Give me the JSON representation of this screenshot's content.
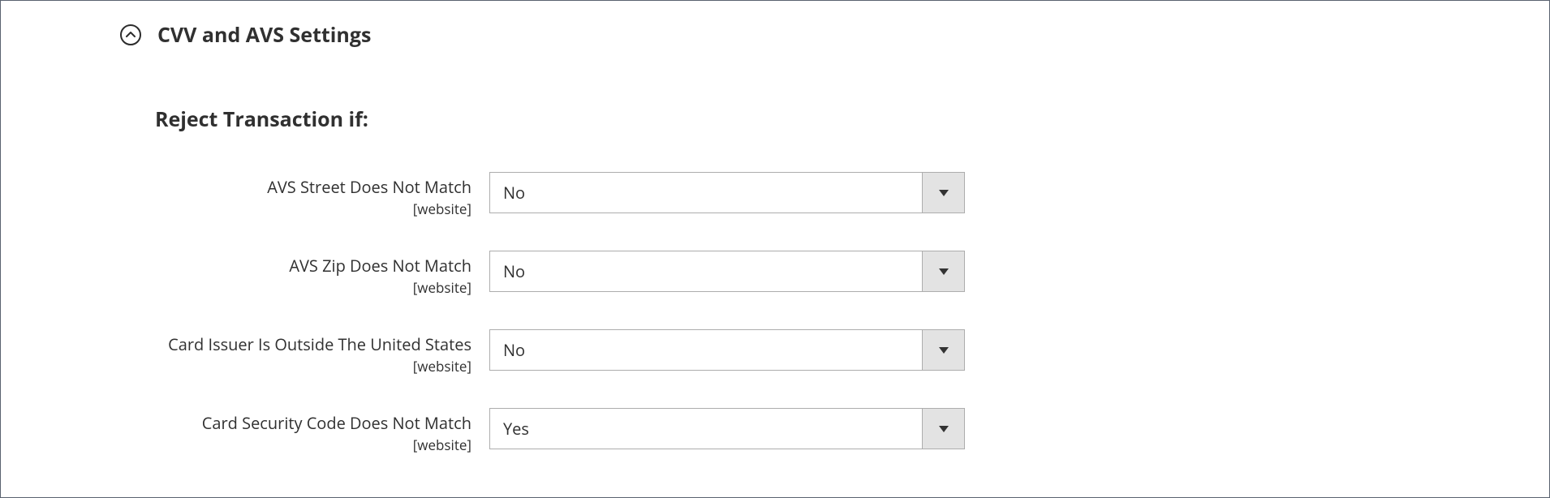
{
  "section": {
    "title": "CVV and AVS Settings"
  },
  "subsection": {
    "title": "Reject Transaction if:"
  },
  "fields": {
    "0": {
      "label": "AVS Street Does Not Match",
      "scope": "[website]",
      "value": "No"
    },
    "1": {
      "label": "AVS Zip Does Not Match",
      "scope": "[website]",
      "value": "No"
    },
    "2": {
      "label": "Card Issuer Is Outside The United States",
      "scope": "[website]",
      "value": "No"
    },
    "3": {
      "label": "Card Security Code Does Not Match",
      "scope": "[website]",
      "value": "Yes"
    }
  }
}
